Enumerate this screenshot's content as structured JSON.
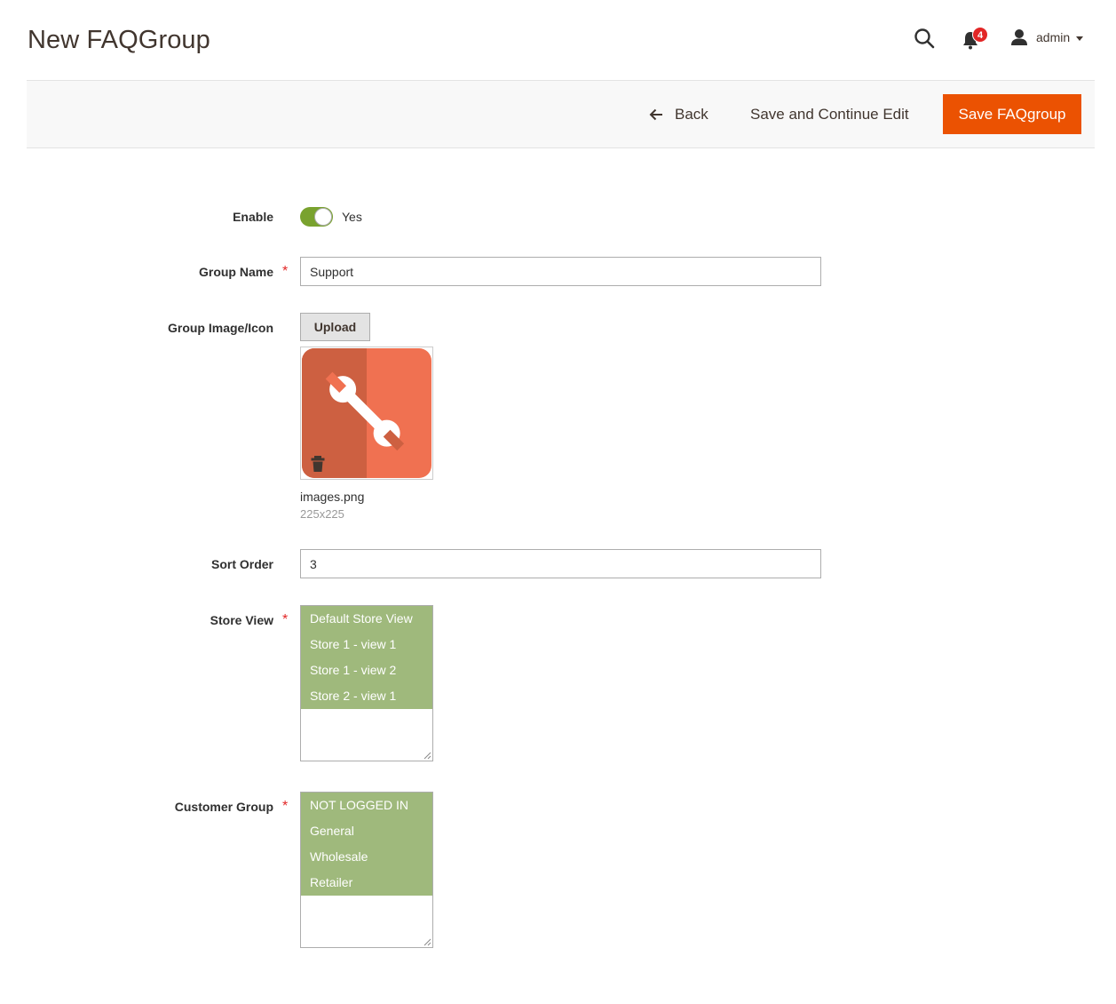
{
  "header": {
    "title": "New FAQGroup",
    "notification_count": "4",
    "user_name": "admin",
    "icons": [
      "search-icon",
      "bell-icon",
      "user-icon",
      "chevron-down-icon"
    ]
  },
  "actions": {
    "back_label": "Back",
    "save_continue_label": "Save and Continue Edit",
    "save_label": "Save FAQgroup"
  },
  "form": {
    "enable": {
      "label": "Enable",
      "state_text": "Yes",
      "checked": true
    },
    "group_name": {
      "label": "Group Name",
      "required": "*",
      "value": "Support"
    },
    "group_image": {
      "label": "Group Image/Icon",
      "upload_label": "Upload",
      "file_name": "images.png",
      "dimensions": "225x225"
    },
    "sort_order": {
      "label": "Sort Order",
      "value": "3"
    },
    "store_view": {
      "label": "Store View",
      "required": "*",
      "options": [
        "Default Store View",
        "Store 1 - view 1",
        "Store 1 - view 2",
        "Store 2 - view 1"
      ]
    },
    "customer_group": {
      "label": "Customer Group",
      "required": "*",
      "options": [
        "NOT LOGGED IN",
        "General",
        "Wholesale",
        "Retailer"
      ]
    }
  },
  "colors": {
    "primary_button": "#eb5202",
    "toggle_on": "#79a22e",
    "selected_option": "#9fb97c",
    "required": "#e22626"
  }
}
